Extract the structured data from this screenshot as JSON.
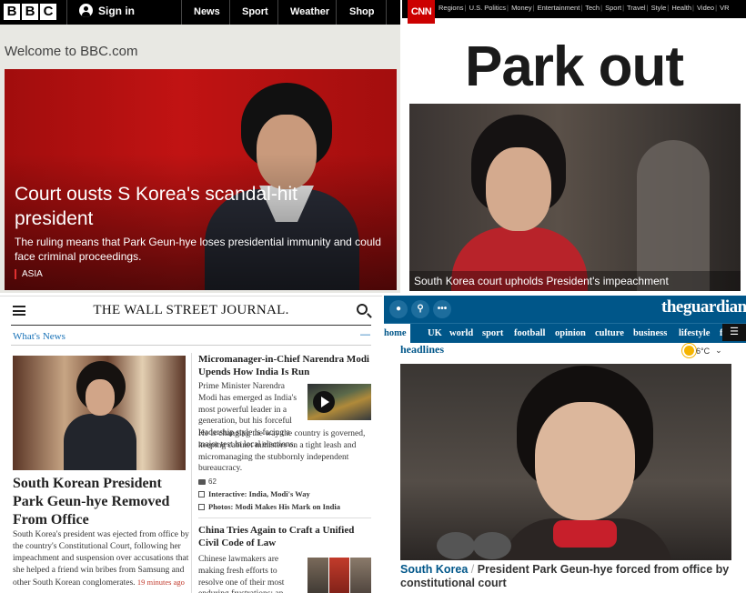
{
  "bbc": {
    "logo": [
      "B",
      "B",
      "C"
    ],
    "signin": "Sign in",
    "nav": [
      "News",
      "Sport",
      "Weather",
      "Shop"
    ],
    "welcome": "Welcome to BBC.com",
    "headline": "Court ousts S Korea's scandal-hit president",
    "summary": "The ruling means that Park Geun-hye loses presidential immunity and could face criminal proceedings.",
    "tag": "ASIA"
  },
  "cnn": {
    "logo": "CNN",
    "nav": [
      "Regions",
      "U.S. Politics",
      "Money",
      "Entertainment",
      "Tech",
      "Sport",
      "Travel",
      "Style",
      "Health",
      "Video",
      "VR"
    ],
    "big_title": "Park out",
    "caption": "South Korea court upholds President's impeachment"
  },
  "wsj": {
    "masthead": "THE WALL STREET JOURNAL.",
    "section": "What's News",
    "dash": "—",
    "lead": {
      "headline": "South Korean President Park Geun-hye Removed From Office",
      "summary": "South Korea's president was ejected from office by the country's Constitutional Court, following her impeachment and suspension over accusations that she helped a friend win bribes from Samsung and other South Korean conglomerates.",
      "time_ago": "19 minutes ago"
    },
    "story1": {
      "headline": "Micromanager-in-Chief Narendra Modi Upends How India Is Run",
      "summary_a": "Prime Minister Narendra Modi has emerged as India's most powerful leader in a generation, but his forceful leadership style is facing a major test in local elections.",
      "summary_b": "He is changing the way the country is governed, keeping cabinet ministers on a tight leash and micromanaging the stubbornly independent bureaucracy.",
      "comments": "62",
      "related": [
        "Interactive: India, Modi's Way",
        "Photos: Modi Makes His Mark on India"
      ]
    },
    "story2": {
      "headline": "China Tries Again to Craft a Unified Civil Code of Law",
      "summary": "Chinese lawmakers are making fresh efforts to resolve one of their most enduring frustrations: an"
    }
  },
  "guardian": {
    "icons": [
      "person-icon",
      "search-icon",
      "more-icon"
    ],
    "brand": "theguardian",
    "nav": [
      "home",
      "UK",
      "world",
      "sport",
      "football",
      "opinion",
      "culture",
      "business",
      "lifestyle",
      "f"
    ],
    "section_title": "headlines",
    "weather": "6°C",
    "caption_section": "South Korea",
    "caption_separator": "/",
    "caption_title": "President Park Geun-hye forced from office by constitutional court"
  }
}
